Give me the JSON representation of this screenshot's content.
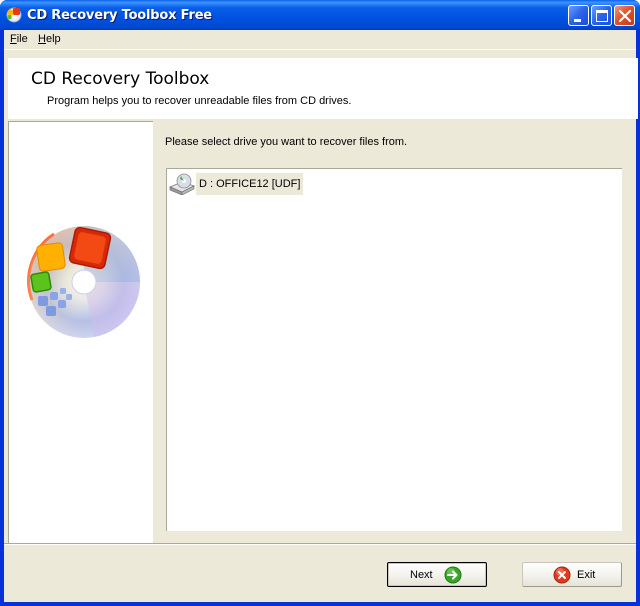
{
  "window": {
    "title": "CD Recovery Toolbox Free",
    "controls": [
      "minimize",
      "maximize",
      "close"
    ]
  },
  "menu": {
    "items": [
      {
        "label": "File",
        "mnemonic": "F",
        "rest": "ile"
      },
      {
        "label": "Help",
        "mnemonic": "H",
        "rest": "elp"
      }
    ]
  },
  "header": {
    "title": "CD Recovery Toolbox",
    "subtitle": "Program helps you to recover unreadable files from CD drives."
  },
  "main": {
    "instruction": "Please select drive you want to recover files from.",
    "drives": [
      {
        "label": "D : OFFICE12 [UDF]",
        "icon": "cd-drive-icon",
        "selected": true
      }
    ]
  },
  "buttons": {
    "next": {
      "label": "Next",
      "icon": "green-arrow-right-icon"
    },
    "exit": {
      "label": "Exit",
      "icon": "red-x-icon"
    }
  },
  "colors": {
    "titlebar": "#0054e3",
    "face": "#ece9d8",
    "selection": "#ece9d8"
  }
}
